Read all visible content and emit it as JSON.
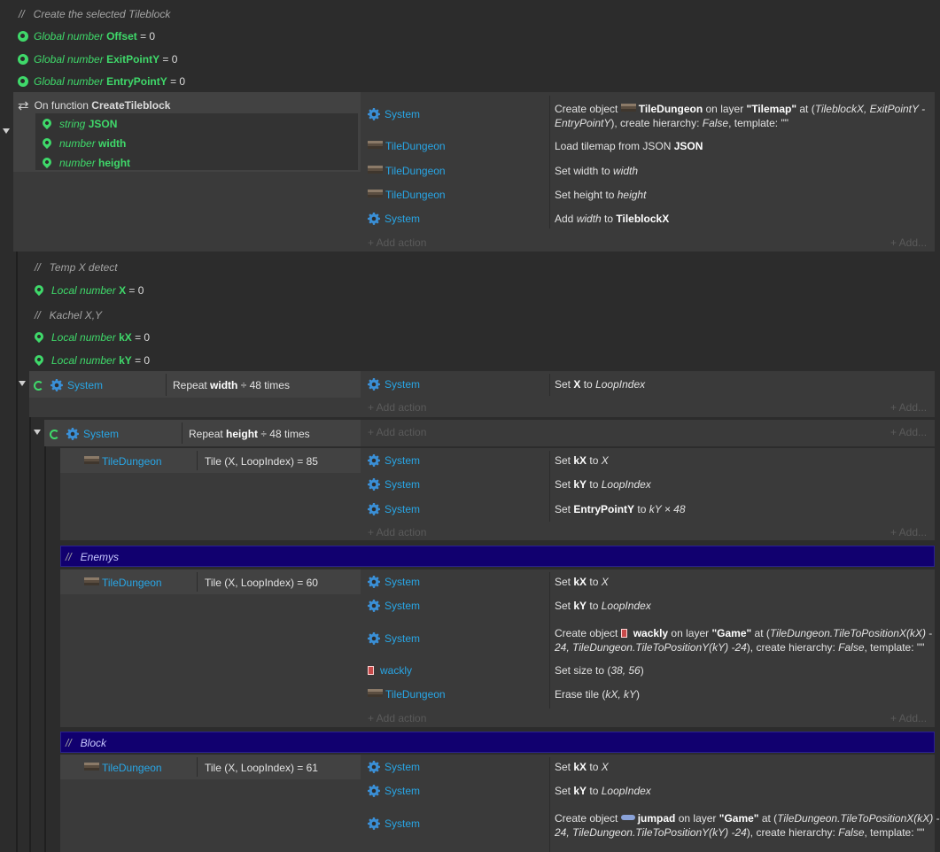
{
  "top_comment": "Create the selected Tileblock",
  "globals": [
    {
      "prefix": "Global number",
      "name": "Offset",
      "value": "= 0"
    },
    {
      "prefix": "Global number",
      "name": "ExitPointY",
      "value": "= 0"
    },
    {
      "prefix": "Global number",
      "name": "EntryPointY",
      "value": "= 0"
    }
  ],
  "function": {
    "label": "On function",
    "name": "CreateTileblock",
    "params": [
      {
        "type": "string",
        "name": "JSON"
      },
      {
        "type": "number",
        "name": "width"
      },
      {
        "type": "number",
        "name": "height"
      }
    ]
  },
  "actions_block1": [
    {
      "object": "System",
      "a1": "Create object ",
      "obj": "TileDungeon",
      "a2": " on layer ",
      "layer": "\"Tilemap\"",
      "a3": " at (",
      "p1": "TileblockX, ExitPointY -",
      "line2": "EntryPointY",
      "a4": "), create hierarchy: ",
      "f": "False",
      "a5": ", template: \"\""
    },
    {
      "object": "TileDungeon",
      "text": "Load tilemap from JSON ",
      "bold": "JSON"
    },
    {
      "object": "TileDungeon",
      "text": "Set width to ",
      "ital": "width"
    },
    {
      "object": "TileDungeon",
      "text": "Set height to ",
      "ital": "height"
    },
    {
      "object": "System",
      "t1": "Add ",
      "ital": "width",
      "t2": " to ",
      "bold": "TileblockX"
    }
  ],
  "add_action": "+ Add action",
  "add_more": "+ Add...",
  "comment_tempx": "Temp X detect",
  "local_x": {
    "prefix": "Local number",
    "name": "X",
    "value": "= 0"
  },
  "comment_kachel": "Kachel X,Y",
  "local_kx": {
    "prefix": "Local number",
    "name": "kX",
    "value": "= 0"
  },
  "local_ky": {
    "prefix": "Local number",
    "name": "kY",
    "value": "= 0"
  },
  "repeat1": {
    "object": "System",
    "t1": "Repeat ",
    "bold": "width",
    "t2": " ÷ 48 times",
    "action_obj": "System",
    "a1": "Set ",
    "ab": "X",
    "a2": " to ",
    "ai": "LoopIndex"
  },
  "repeat2": {
    "object": "System",
    "t1": "Repeat ",
    "bold": "height",
    "t2": " ÷ 48 times"
  },
  "tile85": {
    "object": "TileDungeon",
    "cond": "Tile (X, LoopIndex) = 85",
    "actions": [
      {
        "obj": "System",
        "t1": "Set ",
        "b": "kX",
        "t2": " to ",
        "i": "X"
      },
      {
        "obj": "System",
        "t1": "Set ",
        "b": "kY",
        "t2": " to ",
        "i": "LoopIndex"
      },
      {
        "obj": "System",
        "t1": "Set ",
        "b": "EntryPointY",
        "t2": " to ",
        "i": "kY × 48"
      }
    ]
  },
  "group_enemys": "Enemys",
  "tile60": {
    "object": "TileDungeon",
    "cond": "Tile (X, LoopIndex) = 60",
    "a_setkx": {
      "obj": "System",
      "t1": "Set ",
      "b": "kX",
      "t2": " to ",
      "i": "X"
    },
    "a_setky": {
      "obj": "System",
      "t1": "Set ",
      "b": "kY",
      "t2": " to ",
      "i": "LoopIndex"
    },
    "a_create": {
      "obj": "System",
      "t1": "Create object ",
      "o": "wackly",
      "t2": " on layer ",
      "l": "\"Game\"",
      "t3": " at (",
      "p1": "TileDungeon.TileToPositionX(kX)",
      "t4": " -",
      "line2a": "24, ",
      "p2": "TileDungeon.TileToPositionY(kY) -24",
      "t5": "), create hierarchy: ",
      "f": "False",
      "t6": ", template: \"\""
    },
    "a_size": {
      "obj": "wackly",
      "t1": "Set size to (",
      "i": "38, 56",
      "t2": ")"
    },
    "a_erase": {
      "obj": "TileDungeon",
      "t1": "Erase tile (",
      "i": "kX, kY",
      "t2": ")"
    }
  },
  "group_block": "Block",
  "tile61": {
    "object": "TileDungeon",
    "cond": "Tile (X, LoopIndex) = 61",
    "a_setkx": {
      "obj": "System",
      "t1": "Set ",
      "b": "kX",
      "t2": " to ",
      "i": "X"
    },
    "a_setky": {
      "obj": "System",
      "t1": "Set ",
      "b": "kY",
      "t2": " to ",
      "i": "LoopIndex"
    },
    "a_create": {
      "obj": "System",
      "t1": "Create object ",
      "o": "jumpad",
      "t2": " on layer ",
      "l": "\"Game\"",
      "t3": " at (",
      "p1": "TileDungeon.TileToPositionX(kX)",
      "t4": " -",
      "line2a": "24, ",
      "p2": "TileDungeon.TileToPositionY(kY) -24",
      "t5": "), create hierarchy: ",
      "f": "False",
      "t6": ", template: \"\""
    }
  },
  "colors": {
    "accent_blue": "#28a6e6",
    "var_green": "#3fd96a",
    "group_bg": "#11006f"
  }
}
